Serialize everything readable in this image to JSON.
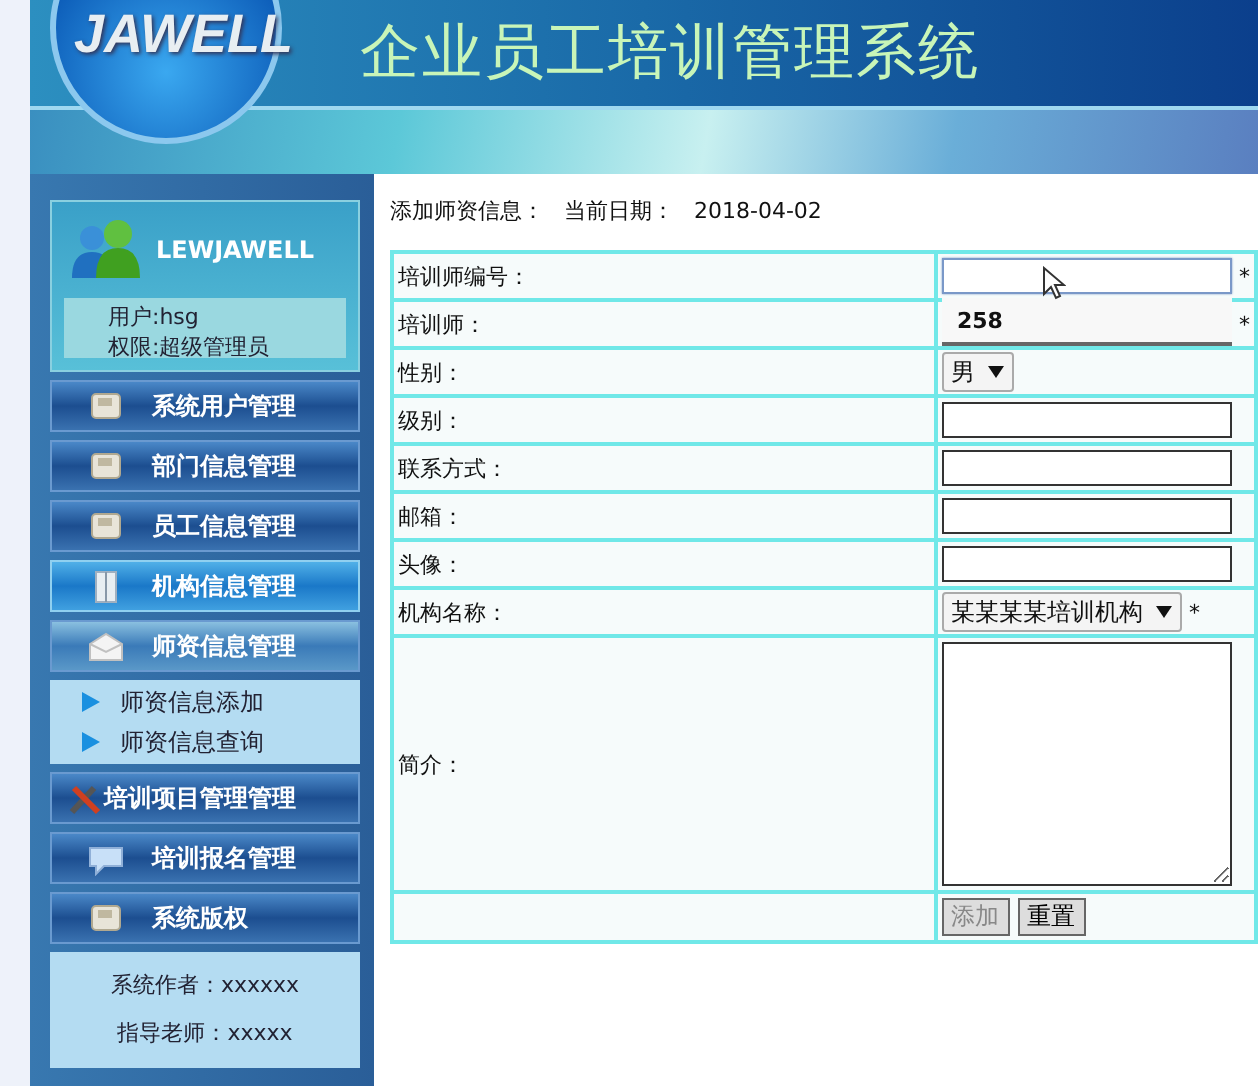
{
  "header": {
    "logo": "JAWELL",
    "title": "企业员工培训管理系统"
  },
  "user_panel": {
    "brand": "LEWJAWELL",
    "user": "用户:hsg",
    "role": "权限:超级管理员"
  },
  "menu": [
    {
      "label": "系统用户管理",
      "selected": false,
      "expanded": false
    },
    {
      "label": "部门信息管理",
      "selected": false,
      "expanded": false
    },
    {
      "label": "员工信息管理",
      "selected": false,
      "expanded": false
    },
    {
      "label": "机构信息管理",
      "selected": true,
      "expanded": false
    },
    {
      "label": "师资信息管理",
      "selected": false,
      "expanded": true,
      "children": [
        "师资信息添加",
        "师资信息查询"
      ]
    },
    {
      "label": "培训项目管理管理",
      "selected": false,
      "expanded": false
    },
    {
      "label": "培训报名管理",
      "selected": false,
      "expanded": false
    },
    {
      "label": "系统版权",
      "selected": false,
      "expanded": false
    }
  ],
  "copyright": [
    {
      "label": "系统作者：",
      "value": "xxxxxx"
    },
    {
      "label": "指导老师：",
      "value": "xxxxx"
    }
  ],
  "form": {
    "heading": "添加师资信息：",
    "date_label": "当前日期：",
    "date": "2018-04-02",
    "fields": [
      {
        "label": "培训师编号：",
        "kind": "text",
        "note": "*",
        "suggestions": [
          "258"
        ]
      },
      {
        "label": "培训师：",
        "kind": "text",
        "note": "*"
      },
      {
        "label": "性别：",
        "kind": "select",
        "value": "男"
      },
      {
        "label": "级别：",
        "kind": "text"
      },
      {
        "label": "联系方式：",
        "kind": "text"
      },
      {
        "label": "邮箱：",
        "kind": "text"
      },
      {
        "label": "头像：",
        "kind": "text"
      },
      {
        "label": "机构名称：",
        "kind": "select",
        "value": "某某某某培训机构",
        "note": "*"
      },
      {
        "label": "简介：",
        "kind": "textarea"
      }
    ],
    "buttons": [
      {
        "label": "添加",
        "disabled": true
      },
      {
        "label": "重置",
        "disabled": false
      }
    ]
  }
}
